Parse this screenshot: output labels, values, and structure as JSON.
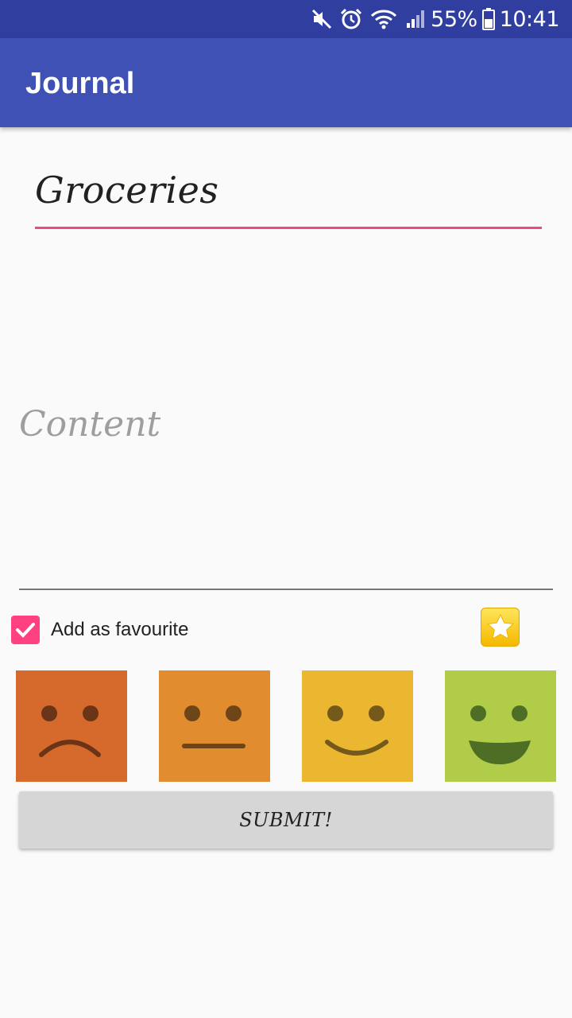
{
  "status_bar": {
    "battery_percent": "55%",
    "time": "10:41",
    "icons": [
      "mute-icon",
      "alarm-icon",
      "wifi-icon",
      "signal-icon",
      "battery-icon"
    ]
  },
  "app_bar": {
    "title": "Journal"
  },
  "form": {
    "title_value": "Groceries",
    "content_placeholder": "Content",
    "favourite_label": "Add as favourite",
    "favourite_checked": true,
    "submit_label": "SUBMIT!"
  },
  "moods": [
    {
      "name": "sad",
      "icon": "sad-face-icon",
      "color": "#d6692c"
    },
    {
      "name": "neutral",
      "icon": "neutral-face-icon",
      "color": "#e08c2f"
    },
    {
      "name": "happy",
      "icon": "smile-face-icon",
      "color": "#ebb730"
    },
    {
      "name": "very-happy",
      "icon": "grin-face-icon",
      "color": "#b0cc48"
    }
  ],
  "colors": {
    "status_bar": "#303f9f",
    "app_bar": "#3f51b5",
    "accent": "#ff4081",
    "star": "#ffd21f"
  }
}
